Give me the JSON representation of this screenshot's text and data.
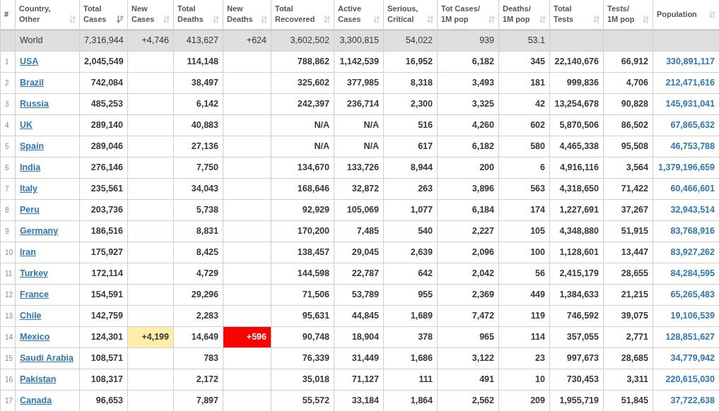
{
  "table": {
    "rank_header": "#",
    "columns": [
      {
        "label": "Country,\nOther",
        "sorted": false
      },
      {
        "label": "Total\nCases",
        "sorted": true
      },
      {
        "label": "New\nCases",
        "sorted": false
      },
      {
        "label": "Total\nDeaths",
        "sorted": false
      },
      {
        "label": "New\nDeaths",
        "sorted": false
      },
      {
        "label": "Total\nRecovered",
        "sorted": false
      },
      {
        "label": "Active\nCases",
        "sorted": false
      },
      {
        "label": "Serious,\nCritical",
        "sorted": false
      },
      {
        "label": "Tot Cases/\n1M pop",
        "sorted": false
      },
      {
        "label": "Deaths/\n1M pop",
        "sorted": false
      },
      {
        "label": "Total\nTests",
        "sorted": false
      },
      {
        "label": "Tests/\n1M pop",
        "sorted": false
      },
      {
        "label": "Population",
        "sorted": false
      }
    ],
    "world": {
      "country": "World",
      "total_cases": "7,316,944",
      "new_cases": "+4,746",
      "total_deaths": "413,627",
      "new_deaths": "+624",
      "total_recovered": "3,602,502",
      "active_cases": "3,300,815",
      "serious_critical": "54,022",
      "tot_cases_per_1m": "939",
      "deaths_per_1m": "53.1"
    },
    "rows": [
      {
        "rank": "1",
        "country": "USA",
        "total_cases": "2,045,549",
        "total_deaths": "114,148",
        "total_recovered": "788,862",
        "active_cases": "1,142,539",
        "serious_critical": "16,952",
        "tot_cases_per_1m": "6,182",
        "deaths_per_1m": "345",
        "total_tests": "22,140,676",
        "tests_per_1m": "66,912",
        "population": "330,891,117"
      },
      {
        "rank": "2",
        "country": "Brazil",
        "total_cases": "742,084",
        "total_deaths": "38,497",
        "total_recovered": "325,602",
        "active_cases": "377,985",
        "serious_critical": "8,318",
        "tot_cases_per_1m": "3,493",
        "deaths_per_1m": "181",
        "total_tests": "999,836",
        "tests_per_1m": "4,706",
        "population": "212,471,616"
      },
      {
        "rank": "3",
        "country": "Russia",
        "total_cases": "485,253",
        "total_deaths": "6,142",
        "total_recovered": "242,397",
        "active_cases": "236,714",
        "serious_critical": "2,300",
        "tot_cases_per_1m": "3,325",
        "deaths_per_1m": "42",
        "total_tests": "13,254,678",
        "tests_per_1m": "90,828",
        "population": "145,931,041"
      },
      {
        "rank": "4",
        "country": "UK",
        "total_cases": "289,140",
        "total_deaths": "40,883",
        "total_recovered": "N/A",
        "active_cases": "N/A",
        "serious_critical": "516",
        "tot_cases_per_1m": "4,260",
        "deaths_per_1m": "602",
        "total_tests": "5,870,506",
        "tests_per_1m": "86,502",
        "population": "67,865,632"
      },
      {
        "rank": "5",
        "country": "Spain",
        "total_cases": "289,046",
        "total_deaths": "27,136",
        "total_recovered": "N/A",
        "active_cases": "N/A",
        "serious_critical": "617",
        "tot_cases_per_1m": "6,182",
        "deaths_per_1m": "580",
        "total_tests": "4,465,338",
        "tests_per_1m": "95,508",
        "population": "46,753,788"
      },
      {
        "rank": "6",
        "country": "India",
        "total_cases": "276,146",
        "total_deaths": "7,750",
        "total_recovered": "134,670",
        "active_cases": "133,726",
        "serious_critical": "8,944",
        "tot_cases_per_1m": "200",
        "deaths_per_1m": "6",
        "total_tests": "4,916,116",
        "tests_per_1m": "3,564",
        "population": "1,379,196,659"
      },
      {
        "rank": "7",
        "country": "Italy",
        "total_cases": "235,561",
        "total_deaths": "34,043",
        "total_recovered": "168,646",
        "active_cases": "32,872",
        "serious_critical": "263",
        "tot_cases_per_1m": "3,896",
        "deaths_per_1m": "563",
        "total_tests": "4,318,650",
        "tests_per_1m": "71,422",
        "population": "60,466,601"
      },
      {
        "rank": "8",
        "country": "Peru",
        "total_cases": "203,736",
        "total_deaths": "5,738",
        "total_recovered": "92,929",
        "active_cases": "105,069",
        "serious_critical": "1,077",
        "tot_cases_per_1m": "6,184",
        "deaths_per_1m": "174",
        "total_tests": "1,227,691",
        "tests_per_1m": "37,267",
        "population": "32,943,514"
      },
      {
        "rank": "9",
        "country": "Germany",
        "total_cases": "186,516",
        "total_deaths": "8,831",
        "total_recovered": "170,200",
        "active_cases": "7,485",
        "serious_critical": "540",
        "tot_cases_per_1m": "2,227",
        "deaths_per_1m": "105",
        "total_tests": "4,348,880",
        "tests_per_1m": "51,915",
        "population": "83,768,916"
      },
      {
        "rank": "10",
        "country": "Iran",
        "total_cases": "175,927",
        "total_deaths": "8,425",
        "total_recovered": "138,457",
        "active_cases": "29,045",
        "serious_critical": "2,639",
        "tot_cases_per_1m": "2,096",
        "deaths_per_1m": "100",
        "total_tests": "1,128,601",
        "tests_per_1m": "13,447",
        "population": "83,927,262"
      },
      {
        "rank": "11",
        "country": "Turkey",
        "total_cases": "172,114",
        "total_deaths": "4,729",
        "total_recovered": "144,598",
        "active_cases": "22,787",
        "serious_critical": "642",
        "tot_cases_per_1m": "2,042",
        "deaths_per_1m": "56",
        "total_tests": "2,415,179",
        "tests_per_1m": "28,655",
        "population": "84,284,595"
      },
      {
        "rank": "12",
        "country": "France",
        "total_cases": "154,591",
        "total_deaths": "29,296",
        "total_recovered": "71,506",
        "active_cases": "53,789",
        "serious_critical": "955",
        "tot_cases_per_1m": "2,369",
        "deaths_per_1m": "449",
        "total_tests": "1,384,633",
        "tests_per_1m": "21,215",
        "population": "65,265,483"
      },
      {
        "rank": "13",
        "country": "Chile",
        "total_cases": "142,759",
        "total_deaths": "2,283",
        "total_recovered": "95,631",
        "active_cases": "44,845",
        "serious_critical": "1,689",
        "tot_cases_per_1m": "7,472",
        "deaths_per_1m": "119",
        "total_tests": "746,592",
        "tests_per_1m": "39,075",
        "population": "19,106,539"
      },
      {
        "rank": "14",
        "country": "Mexico",
        "total_cases": "124,301",
        "new_cases": "+4,199",
        "total_deaths": "14,649",
        "new_deaths": "+596",
        "total_recovered": "90,748",
        "active_cases": "18,904",
        "serious_critical": "378",
        "tot_cases_per_1m": "965",
        "deaths_per_1m": "114",
        "total_tests": "357,055",
        "tests_per_1m": "2,771",
        "population": "128,851,627"
      },
      {
        "rank": "15",
        "country": "Saudi Arabia",
        "total_cases": "108,571",
        "total_deaths": "783",
        "total_recovered": "76,339",
        "active_cases": "31,449",
        "serious_critical": "1,686",
        "tot_cases_per_1m": "3,122",
        "deaths_per_1m": "23",
        "total_tests": "997,673",
        "tests_per_1m": "28,685",
        "population": "34,779,942"
      },
      {
        "rank": "16",
        "country": "Pakistan",
        "total_cases": "108,317",
        "total_deaths": "2,172",
        "total_recovered": "35,018",
        "active_cases": "71,127",
        "serious_critical": "111",
        "tot_cases_per_1m": "491",
        "deaths_per_1m": "10",
        "total_tests": "730,453",
        "tests_per_1m": "3,311",
        "population": "220,615,030"
      },
      {
        "rank": "17",
        "country": "Canada",
        "total_cases": "96,653",
        "total_deaths": "7,897",
        "total_recovered": "55,572",
        "active_cases": "33,184",
        "serious_critical": "1,864",
        "tot_cases_per_1m": "2,562",
        "deaths_per_1m": "209",
        "total_tests": "1,955,719",
        "tests_per_1m": "51,845",
        "population": "37,722,638"
      }
    ]
  }
}
